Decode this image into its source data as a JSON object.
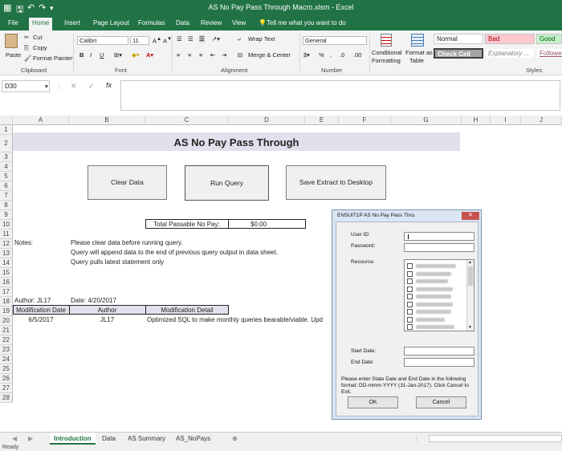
{
  "window": {
    "title": "AS No Pay Pass Through Macro.xlsm  -  Excel"
  },
  "ribbon_tabs": [
    "File",
    "Home",
    "Insert",
    "Page Layout",
    "Formulas",
    "Data",
    "Review",
    "View"
  ],
  "tell_me": "Tell me what you want to do",
  "clipboard": {
    "paste": "Paste",
    "cut": "Cut",
    "copy": "Copy",
    "format_painter": "Format Painter",
    "label": "Clipboard"
  },
  "font": {
    "name": "Calibri",
    "size": "11",
    "label": "Font",
    "bold": "B",
    "italic": "I",
    "underline": "U"
  },
  "alignment": {
    "wrap_text": "Wrap Text",
    "merge_center": "Merge & Center",
    "label": "Alignment"
  },
  "number": {
    "format": "General",
    "label": "Number"
  },
  "styles": {
    "conditional": "Conditional",
    "formatting": "Formatting",
    "format_as": "Format as",
    "table": "Table",
    "normal": "Normal",
    "bad": "Bad",
    "good": "Good",
    "check_cell": "Check Cell",
    "explanatory": "Explanatory ...",
    "followed": "Followe",
    "label": "Styles"
  },
  "formula_bar": {
    "name_box": "D30",
    "cancel": "✕",
    "enter": "✓",
    "fx": "fx"
  },
  "columns": [
    "A",
    "B",
    "C",
    "D",
    "E",
    "F",
    "G",
    "H",
    "I",
    "J"
  ],
  "rows": [
    "1",
    "2",
    "3",
    "4",
    "5",
    "6",
    "7",
    "8",
    "9",
    "10",
    "11",
    "12",
    "13",
    "14",
    "15",
    "16",
    "17",
    "18",
    "19",
    "20",
    "21",
    "22",
    "23",
    "24",
    "25",
    "26",
    "27",
    "28"
  ],
  "sheet": {
    "title": "AS No Pay Pass Through",
    "buttons": {
      "clear": "Clear Data",
      "run": "Run Query",
      "save": "Save Extract to Desktop"
    },
    "total_label": "Total Passable No Pay:",
    "total_value": "$0.00",
    "notes_label": "Notes:",
    "notes": [
      "Please clear data before running query.",
      "Query will append data to the end of previous query output in data sheet.",
      "Query pulls latest statement only"
    ],
    "author_line": "Author: JL17",
    "date_line": "Date: 4/20/2017",
    "table_headers": [
      "Modification Date",
      "Author",
      "Modification Detail"
    ],
    "table_row": [
      "6/5/2017",
      "JL17",
      "Optimized SQL to make monthly queries bearable/viable.  Upd"
    ]
  },
  "dialog": {
    "title": "ENSUIT1P AS No Pay Pass Thru",
    "close": "✕",
    "user_id": "User ID:",
    "password": "Password:",
    "resource": "Resource:",
    "start_date": "Start Date:",
    "end_date": "End Date:",
    "instructions": "Please enter State Date and End Date in the following format: DD-mmm-YYYY (31-Jan-2017). Click Cancel to Exit.",
    "ok": "OK",
    "cancel": "Cancel"
  },
  "sheet_tabs": [
    "Introduction",
    "Data",
    "AS Summary",
    "AS_NoPays"
  ],
  "status": "Ready",
  "colors": {
    "excel_green": "#217346",
    "title_band": "#e4dfec",
    "dialog_frame": "#dbe6f4"
  }
}
